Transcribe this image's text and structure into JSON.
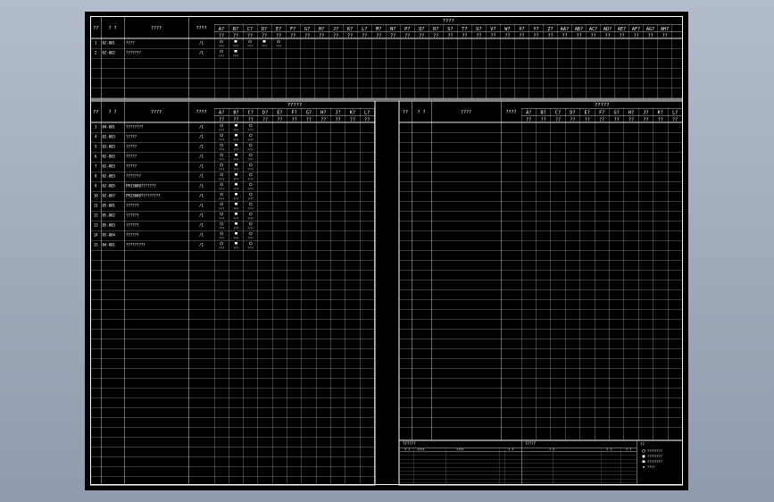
{
  "top_table": {
    "group_header": "????",
    "col_no": "??",
    "col_code": "? ?",
    "col_name": "????",
    "col_qty": "????",
    "columns": [
      "A?",
      "B?",
      "C?",
      "D?",
      "E?",
      "F?",
      "G?",
      "H?",
      "J?",
      "K?",
      "L?",
      "M?",
      "N?",
      "P?",
      "Q?",
      "R?",
      "S?",
      "T?",
      "U?",
      "V?",
      "W?",
      "X?",
      "Y?",
      "Z?",
      "AA?",
      "AB?",
      "AC?",
      "AD?",
      "AE?",
      "AF?",
      "AG?",
      "AH?"
    ],
    "sub_header": "??",
    "rows": [
      {
        "no": "1",
        "code": "02-001",
        "name": "????",
        "qty": "/1"
      },
      {
        "no": "2",
        "code": "02-002",
        "name": "???????",
        "qty": "/1"
      }
    ]
  },
  "left_table": {
    "group_header": "?????",
    "col_no": "??",
    "col_code": "? ?",
    "col_name": "????",
    "col_qty": "????",
    "columns": [
      "A?",
      "B?",
      "C?",
      "D?",
      "E?",
      "F?",
      "G?",
      "H?",
      "J?",
      "K?",
      "L?"
    ],
    "sub_header": "??",
    "rows": [
      {
        "no": "3",
        "code": "04-001",
        "name": "????????",
        "qty": "/1"
      },
      {
        "no": "4",
        "code": "02-003",
        "name": "?????",
        "qty": "/1"
      },
      {
        "no": "5",
        "code": "02-003",
        "name": "?????",
        "qty": "/1"
      },
      {
        "no": "6",
        "code": "02-003",
        "name": "?????",
        "qty": "/1"
      },
      {
        "no": "7",
        "code": "02-003",
        "name": "?????",
        "qty": "/1"
      },
      {
        "no": "8",
        "code": "02-003",
        "name": "???????",
        "qty": "/1"
      },
      {
        "no": "9",
        "code": "02-005",
        "name": "FMJ3000???????",
        "qty": "/1"
      },
      {
        "no": "10",
        "code": "02-007",
        "name": "FMJ3000?????????",
        "qty": "/1"
      },
      {
        "no": "11",
        "code": "05-001",
        "name": "??????",
        "qty": "/1"
      },
      {
        "no": "12",
        "code": "05-002",
        "name": "??????",
        "qty": "/1"
      },
      {
        "no": "13",
        "code": "05-003",
        "name": "??????",
        "qty": "/1"
      },
      {
        "no": "14",
        "code": "05-004",
        "name": "??????",
        "qty": "/1"
      },
      {
        "no": "15",
        "code": "04-001",
        "name": "?????????",
        "qty": "/1"
      }
    ]
  },
  "right_table": {
    "group_header": "?????",
    "col_no": "??",
    "col_code": "? ?",
    "col_name": "????",
    "col_qty": "????",
    "columns": [
      "A?",
      "B?",
      "C?",
      "D?",
      "E?",
      "F?",
      "G?",
      "H?",
      "J?",
      "K?",
      "L?"
    ],
    "sub_header": "??"
  },
  "cell_tags": [
    "????",
    "????",
    "????",
    "????",
    "????"
  ],
  "title_block": {
    "left_head": "??????",
    "left_cols": [
      "? ?",
      "????",
      "????",
      "? ?"
    ],
    "mid_head": "?????",
    "mid_cols": [
      "? ?",
      "? ?",
      "? ?"
    ],
    "legend_head": "??",
    "legend_items": [
      "????????",
      "????????",
      "????????",
      "????"
    ]
  }
}
